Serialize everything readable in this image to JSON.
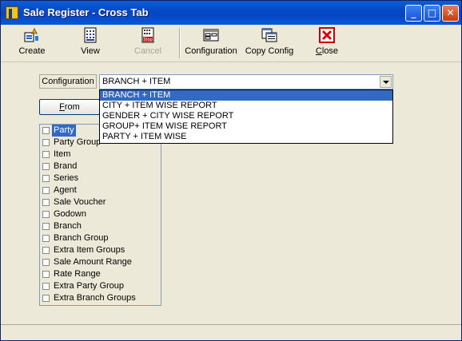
{
  "window": {
    "title": "Sale Register - Cross Tab"
  },
  "toolbar": {
    "create": "Create",
    "view": "View",
    "cancel": "Cancel",
    "configuration": "Configuration",
    "copy_config": "Copy Config",
    "close": "Close"
  },
  "config": {
    "label": "Configuration",
    "selected": "BRANCH + ITEM",
    "options": [
      "BRANCH + ITEM",
      "CITY + ITEM WISE REPORT",
      "GENDER + CITY WISE REPORT",
      "GROUP+ ITEM WISE REPORT",
      "PARTY + ITEM WISE"
    ]
  },
  "from_button": {
    "hotkey": "F",
    "rest": "rom"
  },
  "checklist": {
    "items": [
      "Party",
      "Party Group",
      "Item",
      "Brand",
      "Series",
      "Agent",
      "Sale Voucher",
      "Godown",
      "Branch",
      "Branch Group",
      "Extra Item Groups",
      "Sale Amount Range",
      "Rate Range",
      "Extra Party Group",
      "Extra Branch Groups"
    ]
  },
  "colors": {
    "titlebar": "#0a5fd8",
    "selection": "#316ac5",
    "window_bg": "#ece9d8"
  }
}
